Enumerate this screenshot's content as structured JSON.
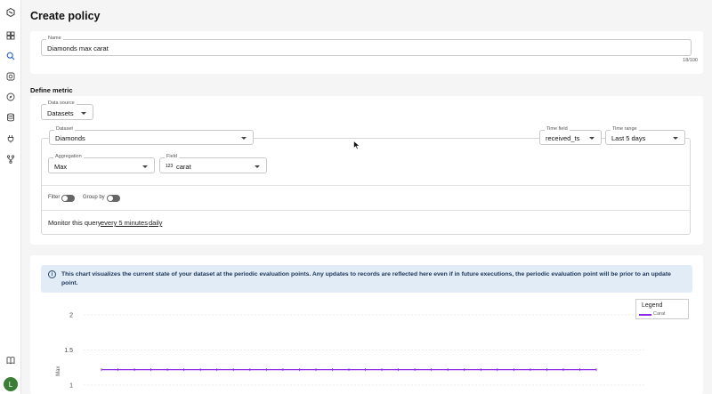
{
  "sidebar": {
    "items": [
      {
        "icon": "logo-icon"
      },
      {
        "icon": "dashboard-icon"
      },
      {
        "icon": "search-icon"
      },
      {
        "icon": "instagram-icon"
      },
      {
        "icon": "compass-icon"
      },
      {
        "icon": "database-icon"
      },
      {
        "icon": "plug-icon"
      },
      {
        "icon": "branch-icon"
      },
      {
        "icon": "book-icon"
      }
    ],
    "avatar_initial": "L",
    "avatar_color": "#3a7d34"
  },
  "header": {
    "title": "Create policy"
  },
  "name_field": {
    "label": "Name",
    "value": "Diamonds max carat",
    "count": "18/100"
  },
  "define_metric": {
    "title": "Define metric",
    "data_source": {
      "label": "Data source",
      "value": "Datasets"
    },
    "dataset": {
      "label": "Dataset",
      "value": "Diamonds"
    },
    "time_field": {
      "label": "Time field",
      "value": "received_ts"
    },
    "time_range": {
      "label": "Time range",
      "value": "Last 5 days"
    },
    "aggregation": {
      "label": "Aggregation",
      "value": "Max"
    },
    "field": {
      "label": "Field",
      "type_glyph": "123",
      "value": "carat"
    },
    "filter_label": "Filter",
    "group_by_label": "Group by",
    "monitor_prefix": "Monitor this query",
    "monitor_interval": "every 5 minutes",
    "monitor_daily": "daily"
  },
  "chart_section": {
    "info_text": "This chart visualizes the current state of your dataset at the periodic evaluation points. Any updates to records are reflected here even if in future executions, the periodic evaluation point will be prior to an update point.",
    "legend_title": "Legend"
  },
  "chart_data": {
    "type": "line",
    "ylabel": "Max",
    "yticks": [
      "2",
      "1.5",
      "1"
    ],
    "ylim": [
      1,
      2
    ],
    "series": [
      {
        "name": "Carat",
        "color": "#8a2be2",
        "values": [
          1.22,
          1.22,
          1.22,
          1.22,
          1.22,
          1.22,
          1.22,
          1.22,
          1.22,
          1.22,
          1.22,
          1.22,
          1.22,
          1.22,
          1.22,
          1.22,
          1.22,
          1.22,
          1.22,
          1.22,
          1.22,
          1.22,
          1.22,
          1.22,
          1.22,
          1.22,
          1.22,
          1.22,
          1.22,
          1.22,
          1.22
        ]
      }
    ],
    "grid": true,
    "legend_position": "top-right"
  }
}
